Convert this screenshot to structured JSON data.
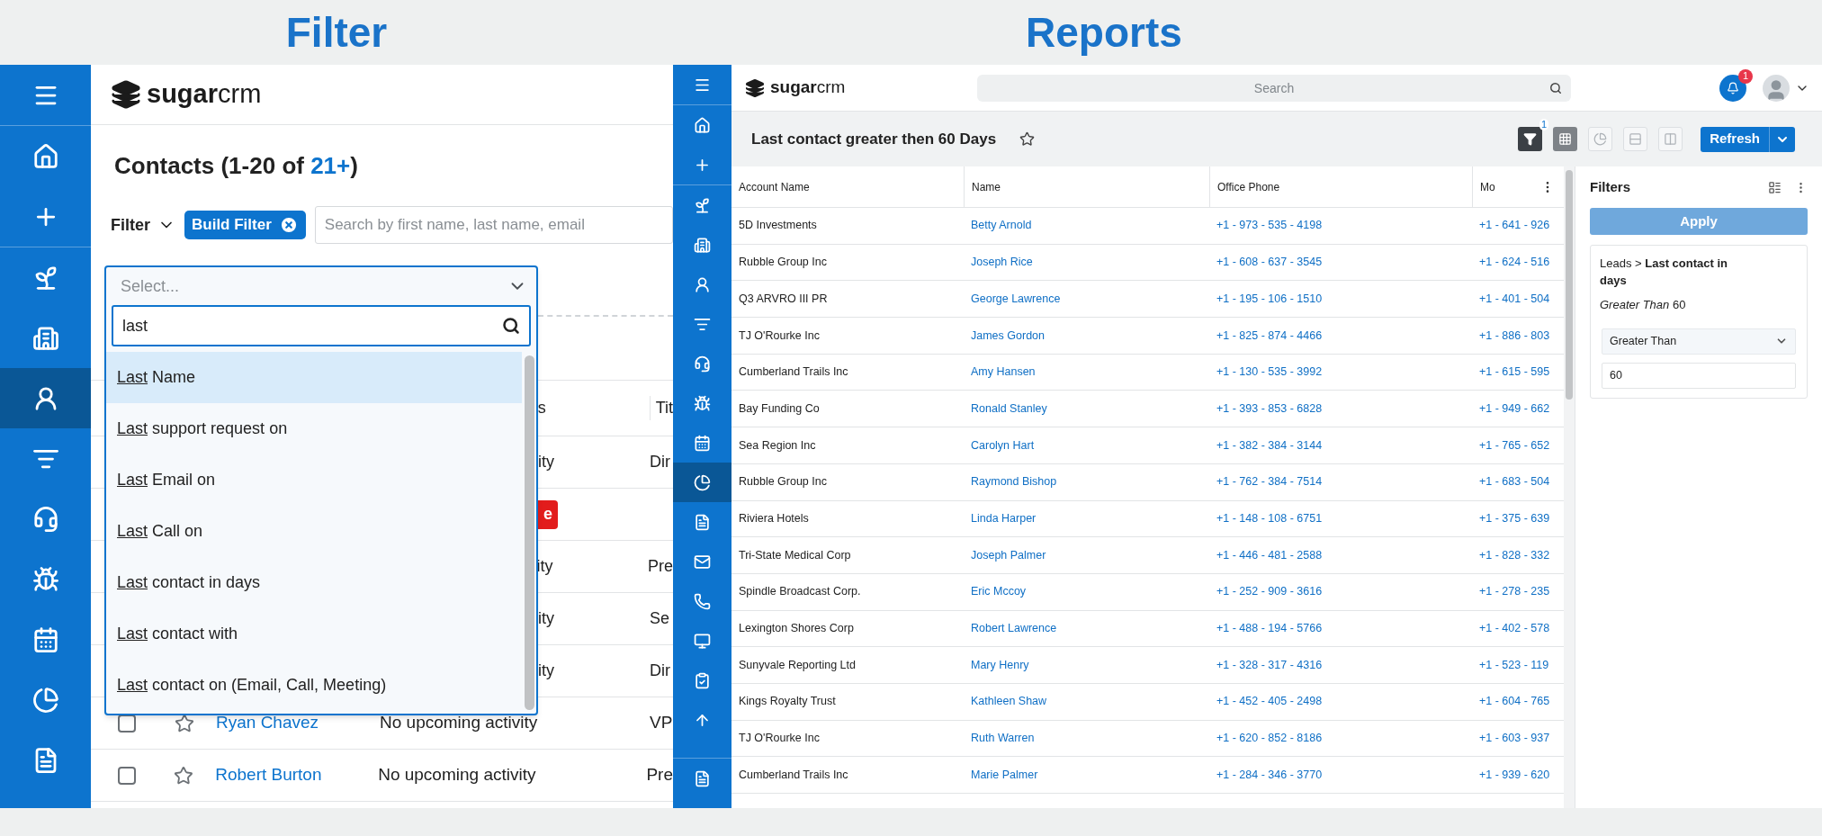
{
  "headings": [
    {
      "text": "Filter"
    },
    {
      "text": "Reports"
    }
  ],
  "filter_screen": {
    "logo": "**sugar**crm",
    "sidebar": {
      "groups": [
        [
          {
            "kind": "menu",
            "selected": false
          }
        ],
        [
          {
            "kind": "home",
            "selected": false
          },
          {
            "kind": "create",
            "selected": false
          }
        ],
        [
          {
            "kind": "sprout",
            "selected": false
          },
          {
            "kind": "building",
            "selected": false
          },
          {
            "kind": "person",
            "selected": true
          },
          {
            "kind": "lines",
            "selected": false
          },
          {
            "kind": "headset",
            "selected": false
          },
          {
            "kind": "bug",
            "selected": false
          },
          {
            "kind": "calendar",
            "selected": false
          },
          {
            "kind": "chart",
            "selected": false
          },
          {
            "kind": "document",
            "selected": false
          }
        ]
      ]
    },
    "title": {
      "text": "Contacts (1-20 of",
      "count": "21+",
      "end": ")"
    },
    "filter_label": "Filter",
    "chip": "Build Filter",
    "search": {
      "placeholder": "Search by first name, last name, email"
    },
    "table": {
      "header": [
        "s",
        "Tit"
      ],
      "covered_rows": [
        {
          "kind": "text",
          "activity": "ity",
          "title": "Dir"
        },
        {
          "kind": "badge",
          "badge": "e"
        },
        {
          "kind": "text",
          "activity": "ity",
          "title": "Pre"
        },
        {
          "kind": "text",
          "activity": "ity",
          "title": "Se"
        },
        {
          "kind": "text",
          "activity": "ity",
          "title": "Dir"
        }
      ],
      "rows": [
        {
          "checked": false,
          "favorite": false,
          "name": "Ryan Chavez",
          "activity": "No upcoming activity",
          "title": "VP"
        },
        {
          "checked": false,
          "favorite": false,
          "name": "Robert Burton",
          "activity": "No upcoming activity",
          "title": "Pre"
        }
      ]
    },
    "dropdown": {
      "placeholder": "Select...",
      "search_value": "last",
      "options": [
        {
          "match": "Last",
          "rest": "Name",
          "selected": true
        },
        {
          "match": "Last",
          "rest": "support request on",
          "selected": false
        },
        {
          "match": "Last",
          "rest": "Email on",
          "selected": false
        },
        {
          "match": "Last",
          "rest": "Call on",
          "selected": false
        },
        {
          "match": "Last",
          "rest": "contact in days",
          "selected": false
        },
        {
          "match": "Last",
          "rest": "contact with",
          "selected": false
        },
        {
          "match": "Last",
          "rest": "contact on (Email, Call, Meeting)",
          "selected": false
        }
      ]
    }
  },
  "reports_screen": {
    "logo": "**sugar**crm",
    "sidebar": {
      "groups": [
        [
          {
            "kind": "menu",
            "selected": false
          }
        ],
        [
          {
            "kind": "home",
            "selected": false
          },
          {
            "kind": "create",
            "selected": false
          }
        ],
        [
          {
            "kind": "sprout",
            "selected": false
          },
          {
            "kind": "building",
            "selected": false
          },
          {
            "kind": "person",
            "selected": false
          },
          {
            "kind": "lines",
            "selected": false
          },
          {
            "kind": "headset",
            "selected": false
          },
          {
            "kind": "bug",
            "selected": false
          },
          {
            "kind": "calendar",
            "selected": false
          },
          {
            "kind": "chart",
            "selected": true
          },
          {
            "kind": "document",
            "selected": false
          },
          {
            "kind": "mail",
            "selected": false
          },
          {
            "kind": "phone",
            "selected": false
          },
          {
            "kind": "monitor",
            "selected": false
          },
          {
            "kind": "tasks",
            "selected": false
          },
          {
            "kind": "upload",
            "selected": false
          }
        ],
        [
          {
            "kind": "document",
            "selected": false
          }
        ]
      ]
    },
    "search": {
      "placeholder": "Search"
    },
    "notification_count": "1",
    "title": "Last contact greater then 60 Days",
    "favorite": false,
    "toolbar": [
      {
        "kind": "filter",
        "selected": true,
        "badge": "1"
      },
      {
        "kind": "table",
        "selected": true
      },
      {
        "kind": "chart",
        "selected": false
      },
      {
        "kind": "rows",
        "selected": false
      },
      {
        "kind": "columns",
        "selected": false
      }
    ],
    "refresh": "Refresh",
    "table": {
      "columns": [
        "Account Name",
        "Name",
        "Office Phone",
        "Mo"
      ],
      "rows": [
        {
          "account": "5D Investments",
          "name": "Betty Arnold",
          "office": "+1 - 973 - 535 - 4198",
          "mobile": "+1 - 641 - 926"
        },
        {
          "account": "Rubble Group Inc",
          "name": "Joseph Rice",
          "office": "+1 - 608 - 637 - 3545",
          "mobile": "+1 - 624 - 516"
        },
        {
          "account": "Q3 ARVRO III PR",
          "name": "George Lawrence",
          "office": "+1 - 195 - 106 - 1510",
          "mobile": "+1 - 401 - 504"
        },
        {
          "account": "TJ O'Rourke Inc",
          "name": "James Gordon",
          "office": "+1 - 825 - 874 - 4466",
          "mobile": "+1 - 886 - 803"
        },
        {
          "account": "Cumberland Trails Inc",
          "name": "Amy Hansen",
          "office": "+1 - 130 - 535 - 3992",
          "mobile": "+1 - 615 - 595"
        },
        {
          "account": "Bay Funding Co",
          "name": "Ronald Stanley",
          "office": "+1 - 393 - 853 - 6828",
          "mobile": "+1 - 949 - 662"
        },
        {
          "account": "Sea Region Inc",
          "name": "Carolyn Hart",
          "office": "+1 - 382 - 384 - 3144",
          "mobile": "+1 - 765 - 652"
        },
        {
          "account": "Rubble Group Inc",
          "name": "Raymond Bishop",
          "office": "+1 - 762 - 384 - 7514",
          "mobile": "+1 - 683 - 504"
        },
        {
          "account": "Riviera Hotels",
          "name": "Linda Harper",
          "office": "+1 - 148 - 108 - 6751",
          "mobile": "+1 - 375 - 639"
        },
        {
          "account": "Tri-State Medical Corp",
          "name": "Joseph Palmer",
          "office": "+1 - 446 - 481 - 2588",
          "mobile": "+1 - 828 - 332"
        },
        {
          "account": "Spindle Broadcast Corp.",
          "name": "Eric Mccoy",
          "office": "+1 - 252 - 909 - 3616",
          "mobile": "+1 - 278 - 235"
        },
        {
          "account": "Lexington Shores Corp",
          "name": "Robert Lawrence",
          "office": "+1 - 488 - 194 - 5766",
          "mobile": "+1 - 402 - 578"
        },
        {
          "account": "Sunyvale Reporting Ltd",
          "name": "Mary Henry",
          "office": "+1 - 328 - 317 - 4316",
          "mobile": "+1 - 523 - 119"
        },
        {
          "account": "Kings Royalty Trust",
          "name": "Kathleen Shaw",
          "office": "+1 - 452 - 405 - 2498",
          "mobile": "+1 - 604 - 765"
        },
        {
          "account": "TJ O'Rourke Inc",
          "name": "Ruth Warren",
          "office": "+1 - 620 - 852 - 8186",
          "mobile": "+1 - 603 - 937"
        },
        {
          "account": "Cumberland Trails Inc",
          "name": "Marie Palmer",
          "office": "+1 - 284 - 346 - 3770",
          "mobile": "+1 - 939 - 620"
        }
      ]
    },
    "filters": {
      "title": "Filters",
      "apply": "Apply",
      "condition": "Leads > **Last contact in days**",
      "summary": "*Greater Than* 60",
      "operator": "Greater Than",
      "value": "60"
    }
  }
}
